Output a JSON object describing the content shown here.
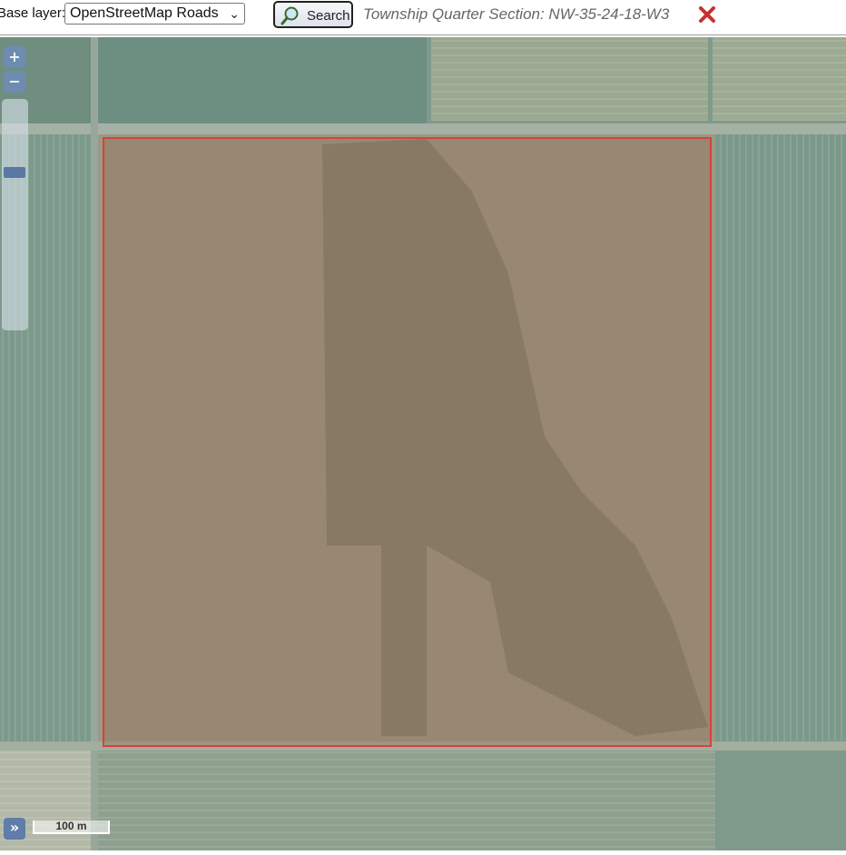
{
  "toolbar": {
    "base_layer_label": "Base layer:",
    "base_layer_selected": "OpenStreetMap Roads",
    "search_label": "Search",
    "section_text": "Township Quarter Section: NW-35-24-18-W3"
  },
  "map": {
    "zoom_in": "+",
    "zoom_out": "−",
    "expand": "»",
    "scale_label": "100 m",
    "parcel_border_color": "#d8423a",
    "icons": [
      "search-icon",
      "close-icon",
      "zoom-in-icon",
      "zoom-out-icon",
      "expand-icon"
    ]
  }
}
